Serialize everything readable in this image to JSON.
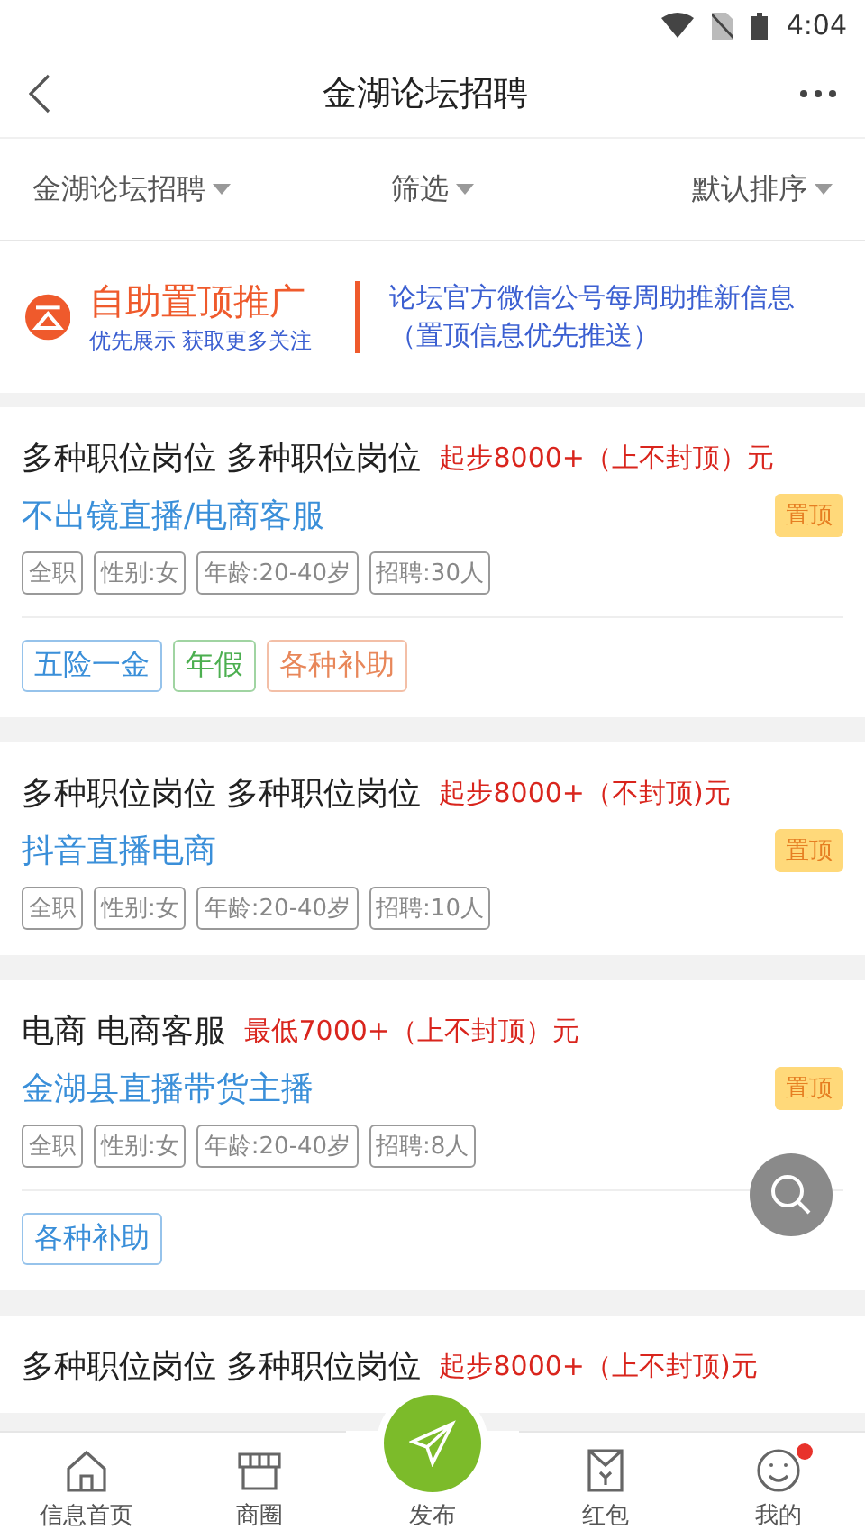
{
  "status_bar": {
    "time": "4:04"
  },
  "header": {
    "title": "金湖论坛招聘"
  },
  "filters": [
    {
      "label": "金湖论坛招聘"
    },
    {
      "label": "筛选"
    },
    {
      "label": "默认排序"
    }
  ],
  "promo": {
    "title": "自助置顶推广",
    "subtitle": "优先展示  获取更多关注",
    "notice": "论坛官方微信公号每周助推新信息（置顶信息优先推送）"
  },
  "jobs": [
    {
      "title": "多种职位岗位 多种职位岗位",
      "salary": "起步8000+（上不封顶）元",
      "position": "不出镜直播/电商客服",
      "pinned": true,
      "pin_label": "置顶",
      "tags": [
        "全职",
        "性别:女",
        "年龄:20-40岁",
        "招聘:30人"
      ],
      "benefits": [
        {
          "label": "五险一金",
          "color": "#3a8fd9"
        },
        {
          "label": "年假",
          "color": "#4caf50"
        },
        {
          "label": "各种补助",
          "color": "#e8875a"
        }
      ]
    },
    {
      "title": "多种职位岗位 多种职位岗位",
      "salary": "起步8000+（不封顶)元",
      "position": "抖音直播电商",
      "pinned": true,
      "pin_label": "置顶",
      "tags": [
        "全职",
        "性别:女",
        "年龄:20-40岁",
        "招聘:10人"
      ]
    },
    {
      "title": "电商 电商客服",
      "salary": "最低7000+（上不封顶）元",
      "position": "金湖县直播带货主播",
      "pinned": true,
      "pin_label": "置顶",
      "tags": [
        "全职",
        "性别:女",
        "年龄:20-40岁",
        "招聘:8人"
      ],
      "benefits": [
        {
          "label": "各种补助",
          "color": "#3a8fd9"
        }
      ]
    },
    {
      "title": "多种职位岗位 多种职位岗位",
      "salary": "起步8000+（上不封顶)元"
    }
  ],
  "tab_bar": [
    {
      "kind": "home",
      "label": "信息首页",
      "badge": false
    },
    {
      "kind": "shop",
      "label": "商圈",
      "badge": false
    },
    {
      "kind": "publish",
      "label": "发布",
      "badge": false
    },
    {
      "kind": "envelope",
      "label": "红包",
      "badge": false
    },
    {
      "kind": "face",
      "label": "我的",
      "badge": true
    }
  ]
}
